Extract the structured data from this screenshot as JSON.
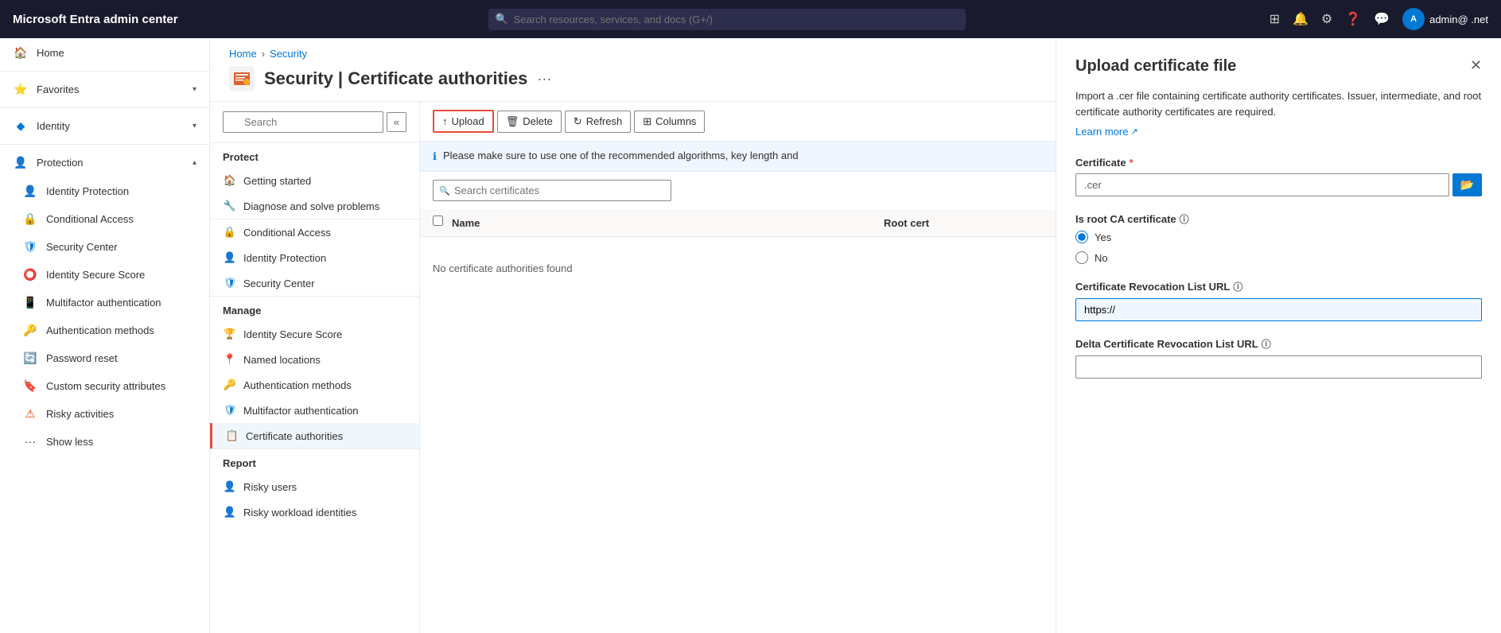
{
  "topbar": {
    "brand": "Microsoft Entra admin center",
    "search_placeholder": "Search resources, services, and docs (G+/)",
    "user": "admin@ .net"
  },
  "sidebar": {
    "home_label": "Home",
    "favorites_label": "Favorites",
    "identity_label": "Identity",
    "protection_label": "Protection",
    "sub_items": [
      {
        "label": "Identity Protection",
        "icon": "👤"
      },
      {
        "label": "Conditional Access",
        "icon": "🔒"
      },
      {
        "label": "Security Center",
        "icon": "🛡"
      },
      {
        "label": "Identity Secure Score",
        "icon": "⭕"
      },
      {
        "label": "Multifactor authentication",
        "icon": "📱"
      },
      {
        "label": "Authentication methods",
        "icon": "🔑"
      },
      {
        "label": "Password reset",
        "icon": "🔄"
      },
      {
        "label": "Custom security attributes",
        "icon": "🔖"
      },
      {
        "label": "Risky activities",
        "icon": "⚠"
      },
      {
        "label": "Show less",
        "icon": "···"
      }
    ]
  },
  "breadcrumb": {
    "home": "Home",
    "security": "Security"
  },
  "page_header": {
    "title": "Security | Certificate authorities",
    "more_icon": "···"
  },
  "left_nav": {
    "search_placeholder": "Search",
    "collapse_icon": "«",
    "sections": [
      {
        "label": "Protect",
        "items": [
          {
            "label": "Getting started",
            "icon": "🏠"
          },
          {
            "label": "Diagnose and solve problems",
            "icon": "🔧"
          }
        ]
      },
      {
        "label": "",
        "items": [
          {
            "label": "Conditional Access",
            "icon": "🔒",
            "color": "green"
          },
          {
            "label": "Identity Protection",
            "icon": "👤",
            "color": "blue"
          },
          {
            "label": "Security Center",
            "icon": "🛡",
            "color": "blue"
          }
        ]
      },
      {
        "label": "Manage",
        "items": [
          {
            "label": "Identity Secure Score",
            "icon": "🏆",
            "color": "gold"
          },
          {
            "label": "Named locations",
            "icon": "📍",
            "color": "blue"
          },
          {
            "label": "Authentication methods",
            "icon": "🔑",
            "color": "blue"
          },
          {
            "label": "Multifactor authentication",
            "icon": "🛡",
            "color": "blue"
          },
          {
            "label": "Certificate authorities",
            "icon": "📋",
            "color": "blue",
            "active": true
          }
        ]
      },
      {
        "label": "Report",
        "items": [
          {
            "label": "Risky users",
            "icon": "👤",
            "color": "blue"
          },
          {
            "label": "Risky workload identities",
            "icon": "👤",
            "color": "blue"
          }
        ]
      }
    ]
  },
  "toolbar": {
    "upload_label": "Upload",
    "delete_label": "Delete",
    "refresh_label": "Refresh",
    "columns_label": "Columns"
  },
  "info_bar": {
    "text": "Please make sure to use one of the recommended algorithms, key length and"
  },
  "search_certs": {
    "placeholder": "Search certificates"
  },
  "table": {
    "col_name": "Name",
    "col_root": "Root cert",
    "empty_text": "No certificate authorities found"
  },
  "side_panel": {
    "title": "Upload certificate file",
    "desc": "Import a .cer file containing certificate authority certificates. Issuer, intermediate, and root certificate authority certificates are required.",
    "learn_more": "Learn more",
    "cert_label": "Certificate",
    "cert_placeholder": ".cer",
    "is_root_label": "Is root CA certificate",
    "yes_label": "Yes",
    "no_label": "No",
    "crl_label": "Certificate Revocation List URL",
    "crl_placeholder": "https://",
    "delta_crl_label": "Delta Certificate Revocation List URL",
    "delta_crl_placeholder": ""
  }
}
